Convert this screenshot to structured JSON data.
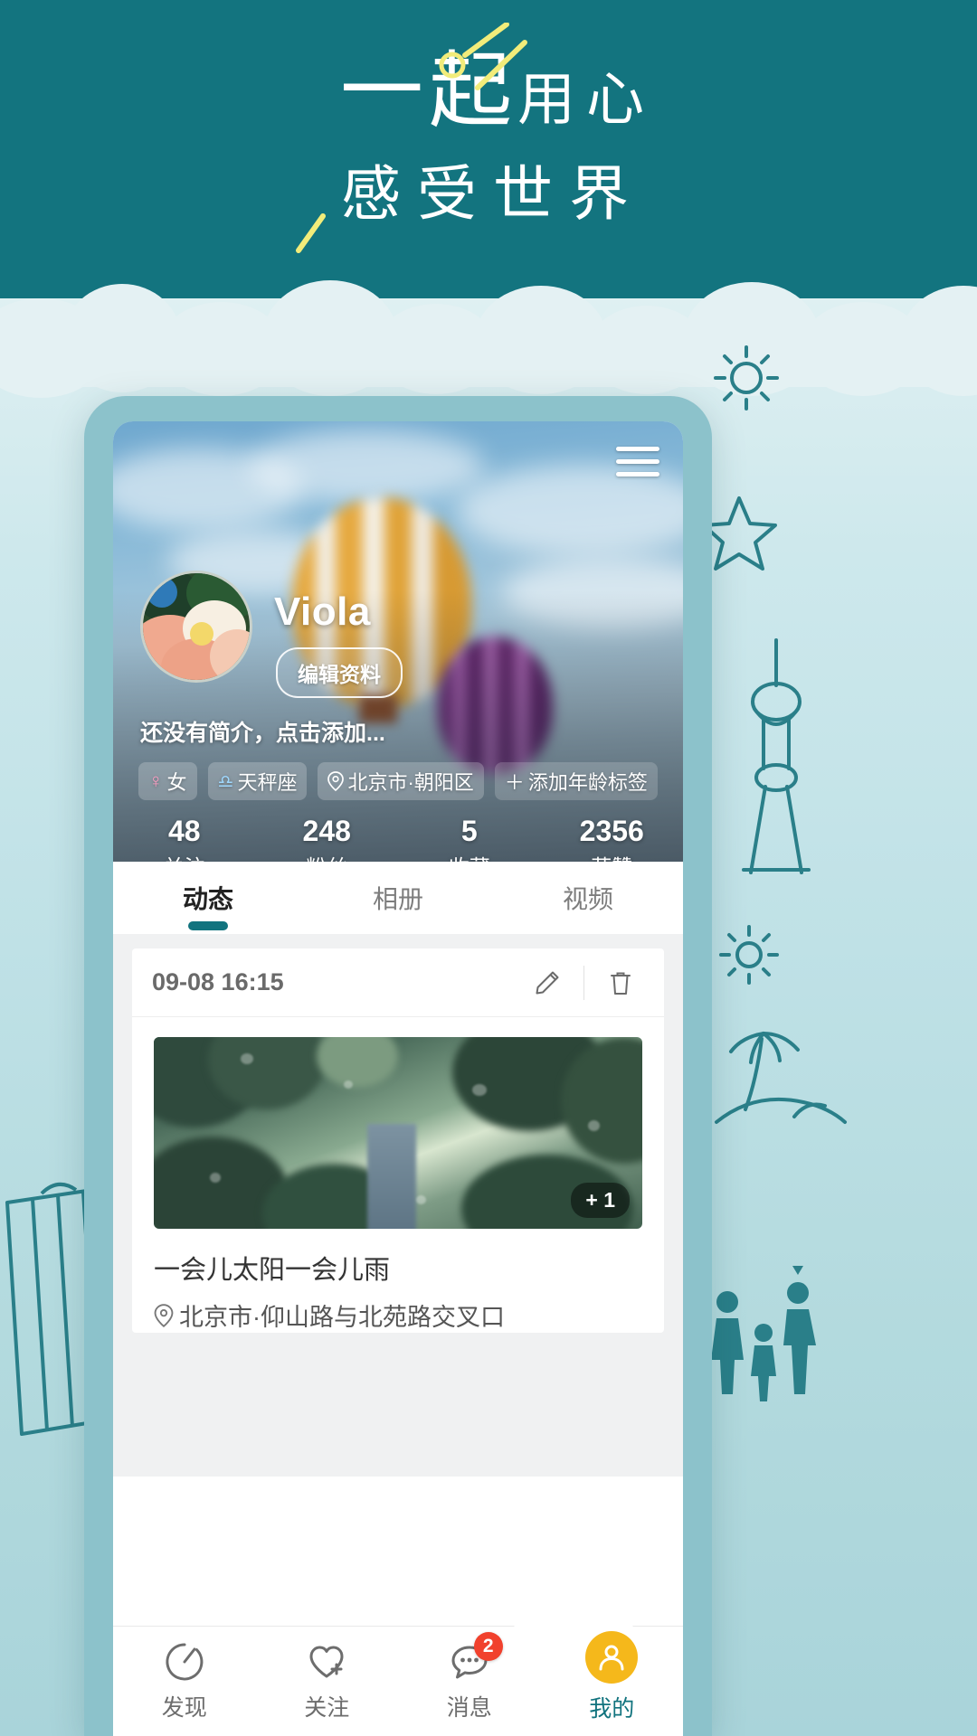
{
  "promo": {
    "line1_big": "一起",
    "line1_small": "用心",
    "line2": "感受世界"
  },
  "phone": {
    "profile": {
      "menu_icon": "hamburger-icon",
      "username": "Viola",
      "edit_button": "编辑资料",
      "bio_placeholder": "还没有简介，点击添加...",
      "tags": [
        {
          "icon": "female-icon",
          "glyph": "♀",
          "label": "女",
          "type": "gender"
        },
        {
          "icon": "libra-icon",
          "glyph": "♎",
          "label": "天秤座",
          "type": "zodiac"
        },
        {
          "icon": "location-pin-icon",
          "glyph": "◎",
          "label": "北京市·朝阳区",
          "type": "location"
        },
        {
          "icon": "plus-icon",
          "glyph": "＋",
          "label": "添加年龄标签",
          "type": "add-age"
        }
      ],
      "stats": [
        {
          "num": "48",
          "label": "关注"
        },
        {
          "num": "248",
          "label": "粉丝"
        },
        {
          "num": "5",
          "label": "收藏"
        },
        {
          "num": "2356",
          "label": "获赞"
        }
      ]
    },
    "tabs": [
      {
        "label": "动态",
        "active": true
      },
      {
        "label": "相册",
        "active": false
      },
      {
        "label": "视频",
        "active": false
      }
    ],
    "post": {
      "date": "09-08 16:15",
      "edit_icon": "pencil-icon",
      "delete_icon": "trash-icon",
      "image_count_badge": "+ 1",
      "caption": "一会儿太阳一会儿雨",
      "location": "北京市·仰山路与北苑路交叉口",
      "location_icon": "location-pin-icon"
    },
    "bottom_nav": [
      {
        "label": "发现",
        "icon": "compass-icon",
        "active": false,
        "badge": ""
      },
      {
        "label": "关注",
        "icon": "heart-plus-icon",
        "active": false,
        "badge": ""
      },
      {
        "label": "消息",
        "icon": "chat-bubble-icon",
        "active": false,
        "badge": "2"
      },
      {
        "label": "我的",
        "icon": "user-avatar-icon",
        "active": true,
        "badge": ""
      }
    ]
  },
  "colors": {
    "brand_teal": "#13747f",
    "accent_yellow": "#f5b81b",
    "badge_red": "#f1412d",
    "headline_spark": "#f2ec7a"
  }
}
